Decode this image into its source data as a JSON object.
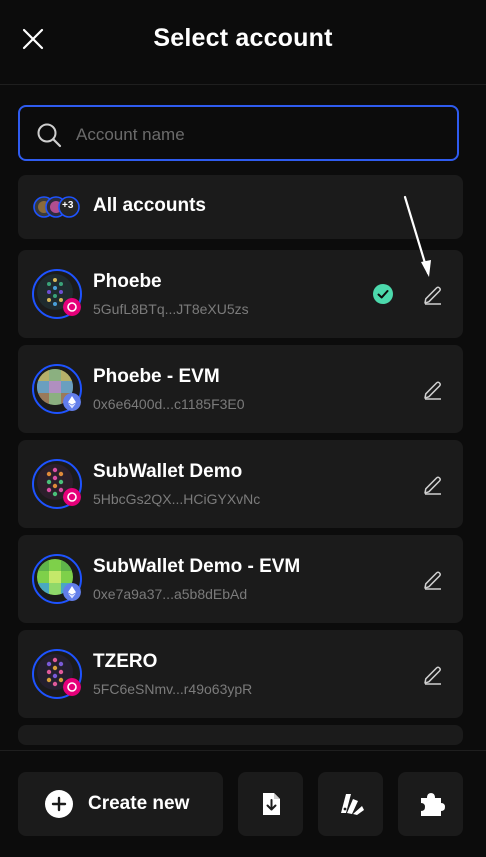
{
  "header": {
    "title": "Select account"
  },
  "search": {
    "placeholder": "Account name",
    "value": ""
  },
  "all_accounts": {
    "label": "All accounts",
    "extra_count": "+3"
  },
  "accounts": [
    {
      "name": "Phoebe",
      "address": "5GufL8BTq...JT8eXU5zs",
      "chain": "polkadot",
      "selected": true
    },
    {
      "name": "Phoebe - EVM",
      "address": "0x6e6400d...c1185F3E0",
      "chain": "ethereum",
      "selected": false
    },
    {
      "name": "SubWallet Demo",
      "address": "5HbcGs2QX...HCiGYXvNc",
      "chain": "polkadot",
      "selected": false
    },
    {
      "name": "SubWallet Demo - EVM",
      "address": "0xe7a9a37...a5b8dEbAd",
      "chain": "ethereum",
      "selected": false
    },
    {
      "name": "TZERO",
      "address": "5FC6eSNmv...r49o63ypR",
      "chain": "polkadot",
      "selected": false
    }
  ],
  "footer": {
    "create_label": "Create new",
    "import_icon": "import-file-icon",
    "attach_icon": "attach-account-icon",
    "extension_icon": "puzzle-extension-icon"
  },
  "colors": {
    "background": "#0c0c0c",
    "card": "#1b1b1b",
    "accent": "#2f5cf0",
    "selected_check": "#4cd9ac",
    "polkadot_badge": "#e6007a",
    "ethereum_badge": "#627eea",
    "muted_text": "#7b7b7b"
  }
}
